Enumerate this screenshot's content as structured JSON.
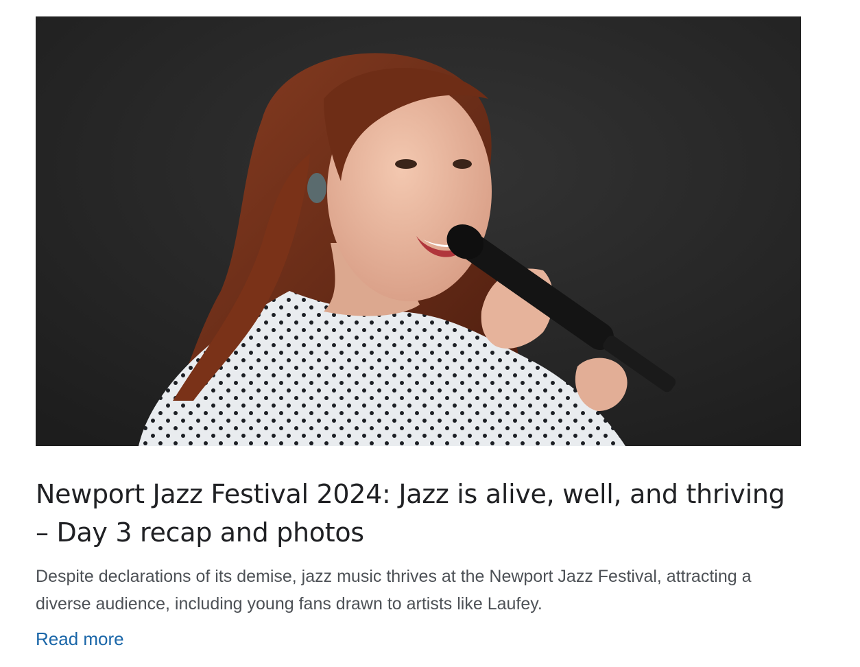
{
  "article": {
    "image_alt": "Singer performing with a microphone on stage",
    "title": "Newport Jazz Festival 2024: Jazz is alive, well, and thriving – Day 3 recap and photos",
    "summary": "Despite declarations of its demise, jazz music thrives at the Newport Jazz Festival, attracting a diverse audience, including young fans drawn to artists like Laufey.",
    "read_more_label": "Read more"
  },
  "colors": {
    "title": "#202124",
    "summary": "#4d5156",
    "link": "#1a66a8",
    "image_background": "#232323"
  }
}
